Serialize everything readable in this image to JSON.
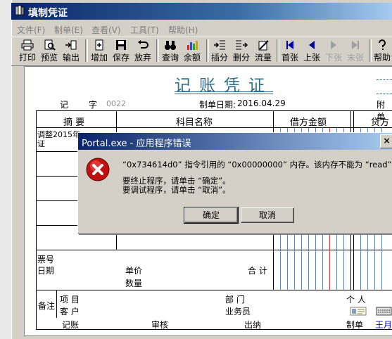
{
  "window": {
    "title": "填制凭证"
  },
  "menu": [
    {
      "label": "文件(F)"
    },
    {
      "label": "制单(E)"
    },
    {
      "label": "查看(V)"
    },
    {
      "label": "工具(T)"
    },
    {
      "label": "帮助(H)"
    }
  ],
  "toolbar": [
    {
      "label": "打印",
      "icon": "printer-icon"
    },
    {
      "label": "预览",
      "icon": "preview-icon"
    },
    {
      "label": "输出",
      "icon": "export-icon"
    },
    {
      "label": "增加",
      "icon": "add-icon"
    },
    {
      "label": "保存",
      "icon": "save-icon"
    },
    {
      "label": "放弃",
      "icon": "undo-icon"
    },
    {
      "label": "查询",
      "icon": "binoculars-icon"
    },
    {
      "label": "余额",
      "icon": "balance-icon"
    },
    {
      "label": "插分",
      "icon": "insert-row-icon"
    },
    {
      "label": "删分",
      "icon": "delete-row-icon"
    },
    {
      "label": "流量",
      "icon": "flow-icon"
    },
    {
      "label": "首张",
      "icon": "first-icon"
    },
    {
      "label": "上张",
      "icon": "prev-icon"
    },
    {
      "label": "下张",
      "icon": "next-icon"
    },
    {
      "label": "末张",
      "icon": "last-icon"
    },
    {
      "label": "帮助",
      "icon": "help-icon"
    }
  ],
  "voucher": {
    "title": "记账凭证",
    "type_label": "记",
    "zi_label": "字",
    "number": "0022",
    "date_label": "制单日期:",
    "date": "2016.04.29",
    "attach_label": "附单",
    "col_summary": "摘 要",
    "col_account": "科目名称",
    "col_debit": "借方金额",
    "col_credit": "贷方",
    "row1_summary": "调整2015年",
    "row1_summary2": "证",
    "bill_no_label": "票号",
    "date2_label": "日期",
    "unit_price_label": "单价",
    "quantity_label": "数量",
    "total_label": "合 计",
    "remark_label": "备注",
    "project_label": "项  目",
    "customer_label": "客  户",
    "dept_label": "部  门",
    "person_label": "个  人",
    "salesman_label": "业务员",
    "bookkeeper_label": "记账",
    "auditor_label": "审核",
    "cashier_label": "出纳",
    "maker_label": "制单",
    "maker_name": "王月"
  },
  "dialog": {
    "title": "Portal.exe - 应用程序错误",
    "message": "“0x734614d0” 指令引用的 “0x00000000” 内存。该内存不能为 “read”。",
    "line2": "要终止程序，请单击 “确定”。",
    "line3": "要调试程序，请单击 “取消”。",
    "ok": "确定",
    "cancel": "取消"
  }
}
